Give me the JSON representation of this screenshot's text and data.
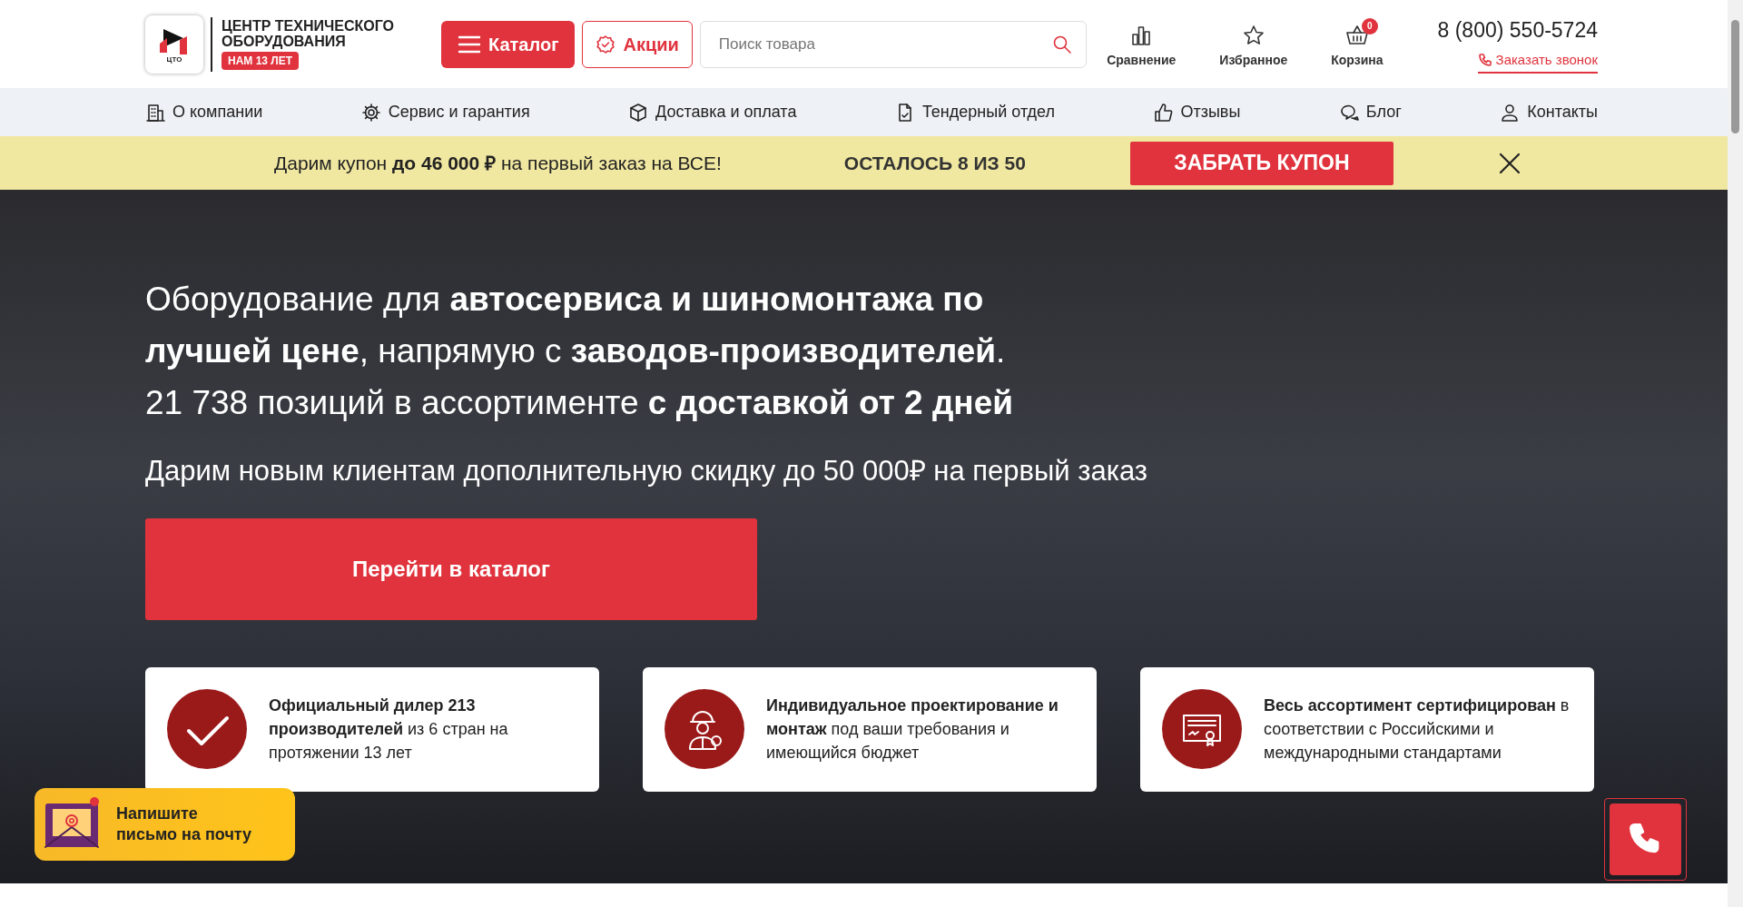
{
  "header": {
    "logo": {
      "mark": "ЦТО",
      "title": "ЦЕНТР ТЕХНИЧЕСКОГО ОБОРУДОВАНИЯ",
      "badge": "НАМ 13 ЛЕТ"
    },
    "catalog_button": "Каталог",
    "promo_button": "Акции",
    "search": {
      "placeholder": "Поиск товара"
    },
    "actions": [
      {
        "kind": "compare",
        "label": "Сравнение"
      },
      {
        "kind": "favorites",
        "label": "Избранное"
      },
      {
        "kind": "cart",
        "label": "Корзина",
        "count": "0"
      }
    ],
    "phone": "8 (800) 550-5724",
    "callback_link": "Заказать звонок"
  },
  "nav": [
    {
      "kind": "building",
      "label": "О компании"
    },
    {
      "kind": "gear",
      "label": "Сервис и гарантия"
    },
    {
      "kind": "box",
      "label": "Доставка и оплата"
    },
    {
      "kind": "document",
      "label": "Тендерный отдел"
    },
    {
      "kind": "thumb",
      "label": "Отзывы"
    },
    {
      "kind": "chat",
      "label": "Блог"
    },
    {
      "kind": "person",
      "label": "Контакты"
    }
  ],
  "coupon_bar": {
    "text": "Дарим купон **до 46 000 ₽** на первый заказ на ВСЕ!",
    "remaining": "ОСТАЛОСЬ 8 ИЗ 50",
    "button": "ЗАБРАТЬ КУПОН"
  },
  "hero": {
    "heading_lines": [
      "Оборудование для **автосервиса и шиномонтажа по лучшей цене**, напрямую с **заводов-производителей**.",
      "21 738 позиций в ассортименте **с доставкой от 2 дней**"
    ],
    "subtitle": "Дарим новым клиентам дополнительную скидку до 50 000₽ на первый заказ",
    "button": "Перейти в каталог",
    "features": [
      {
        "kind": "check",
        "text": "**Официальный дилер 213 производителей** из 6 стран на протяжении 13 лет"
      },
      {
        "kind": "engineer",
        "text": "**Индивидуальное проектирование и монтаж** под ваши требования и имеющийся бюджет"
      },
      {
        "kind": "certificate",
        "text": "**Весь ассортимент сертифицирован** в соответствии с Российскими и международными стандартами"
      }
    ]
  },
  "mail_widget": {
    "text": "Напишите письмо на почту"
  }
}
